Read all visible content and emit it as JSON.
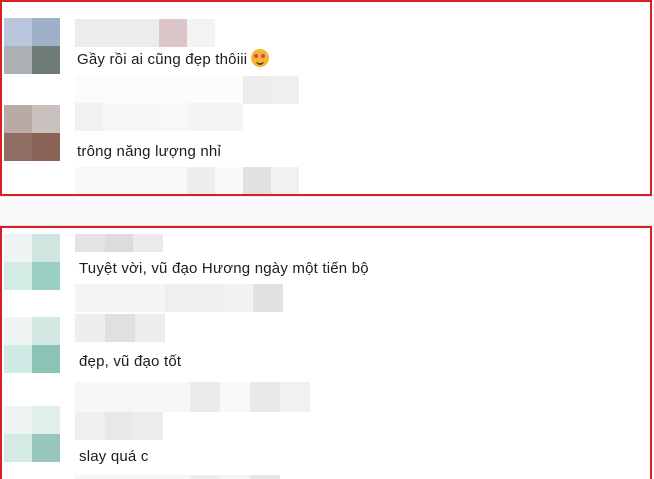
{
  "top_section": {
    "comments": [
      {
        "text": "Gầy rồi ai cũng đẹp thôiii",
        "reaction": "smiling-face-with-hearts-icon"
      },
      {
        "text": "trông năng lượng nhỉ"
      }
    ]
  },
  "bottom_section": {
    "comments": [
      {
        "text": "Tuyệt vời, vũ đạo Hương ngày một tiến bộ"
      },
      {
        "text": "đẹp, vũ đạo tốt"
      },
      {
        "text": "slay quá c"
      }
    ]
  },
  "colors": {
    "highlight_border": "#d81f26",
    "comment_text": "#1c1c1c"
  }
}
